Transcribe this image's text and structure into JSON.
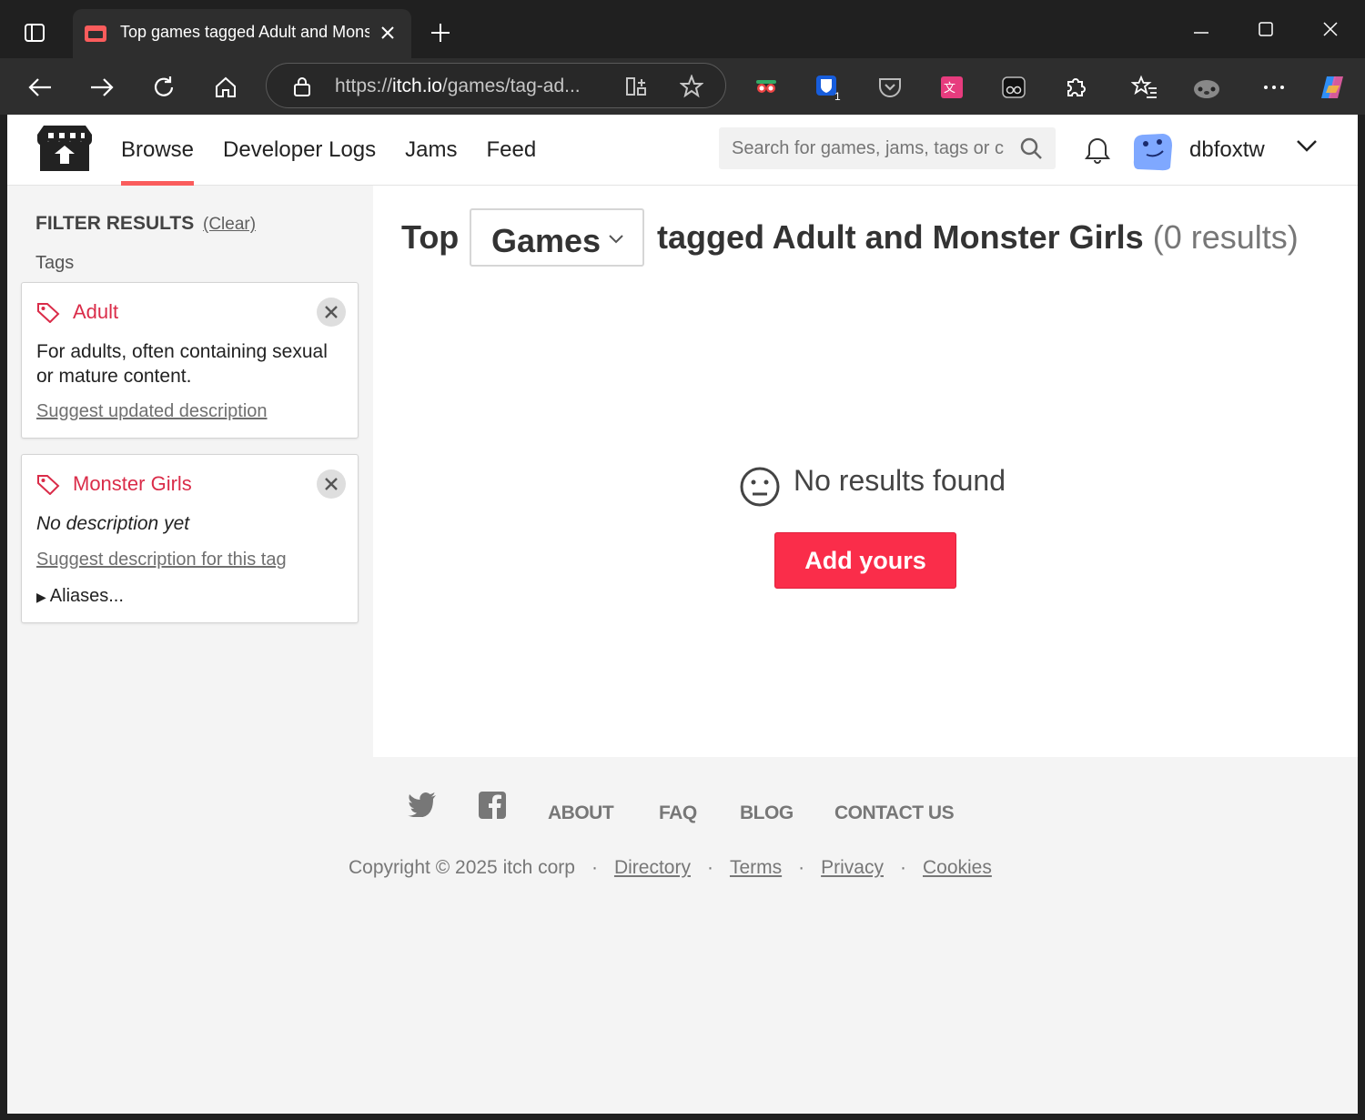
{
  "browser": {
    "tab_title": "Top games tagged Adult and Monster Girls",
    "url_prefix": "https://",
    "url_host": "itch.io",
    "url_path": "/games/tag-ad...",
    "extension_badge": "1"
  },
  "header": {
    "nav": [
      "Browse",
      "Developer Logs",
      "Jams",
      "Feed"
    ],
    "active_nav": "Browse",
    "search_placeholder": "Search for games, jams, tags or c",
    "username": "dbfoxtw"
  },
  "sidebar": {
    "filter_title": "FILTER RESULTS",
    "clear_label": "(Clear)",
    "tags_label": "Tags",
    "tags": [
      {
        "name": "Adult",
        "description": "For adults, often containing sexual or mature content.",
        "link": "Suggest updated description"
      },
      {
        "name": "Monster Girls",
        "description": "No description yet",
        "link": "Suggest description for this tag",
        "aliases": "Aliases..."
      }
    ]
  },
  "main": {
    "heading_prefix": "Top",
    "type_select": "Games",
    "heading_tagged": "tagged Adult and Monster Girls",
    "result_count": "(0 results)",
    "empty_text": "No results found",
    "add_button": "Add yours"
  },
  "footer": {
    "links": [
      "ABOUT",
      "FAQ",
      "BLOG",
      "CONTACT US"
    ],
    "copyright": "Copyright © 2025 itch corp",
    "legal_links": [
      "Directory",
      "Terms",
      "Privacy",
      "Cookies"
    ]
  },
  "colors": {
    "brand_red": "#fa5c5c",
    "tag_red": "#da2c49",
    "button_red": "#fa2d4a"
  }
}
